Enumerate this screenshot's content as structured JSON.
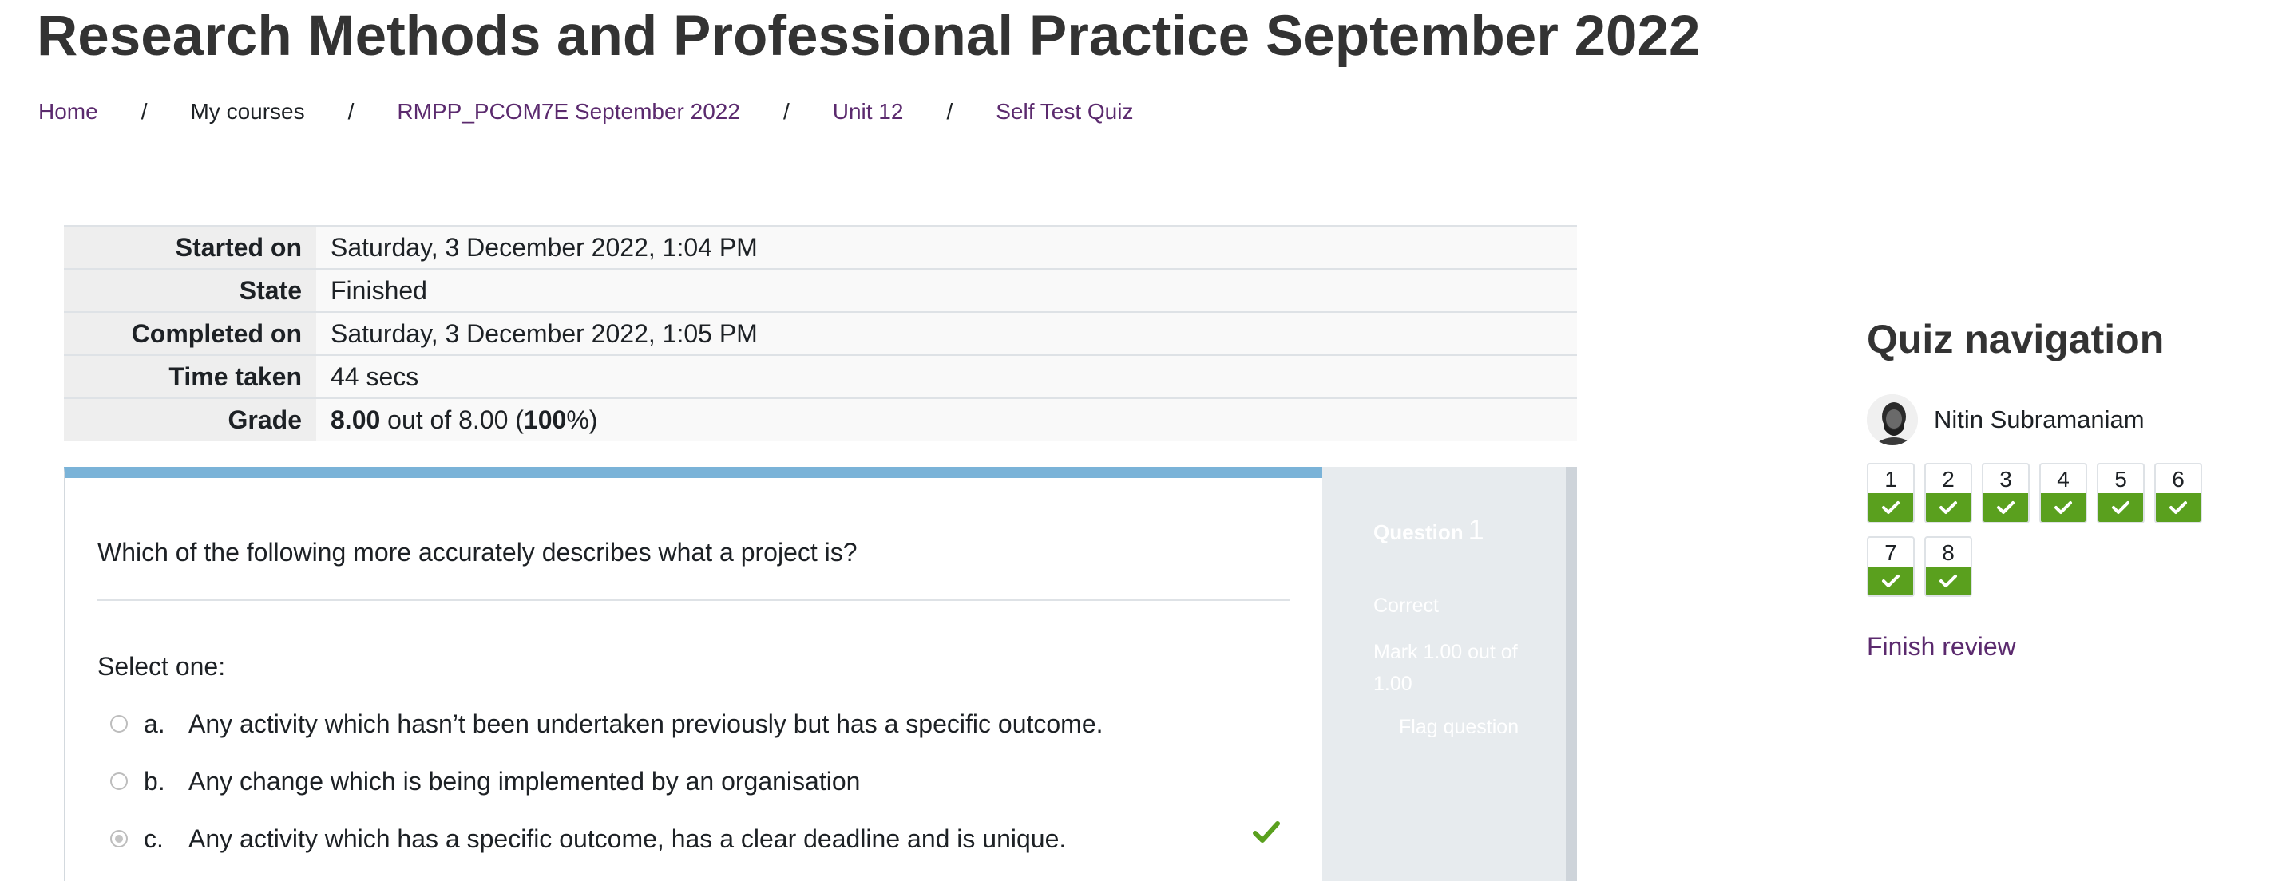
{
  "page": {
    "title": "Research Methods and Professional Practice September 2022"
  },
  "breadcrumb": {
    "items": [
      {
        "label": "Home"
      },
      {
        "label": "My courses"
      },
      {
        "label": "RMPP_PCOM7E September 2022"
      },
      {
        "label": "Unit 12"
      },
      {
        "label": "Self Test Quiz"
      }
    ],
    "separator": "/"
  },
  "summary": {
    "rows": [
      {
        "label": "Started on",
        "value": "Saturday, 3 December 2022, 1:04 PM"
      },
      {
        "label": "State",
        "value": "Finished"
      },
      {
        "label": "Completed on",
        "value": "Saturday, 3 December 2022, 1:05 PM"
      },
      {
        "label": "Time taken",
        "value": "44 secs"
      },
      {
        "label": "Grade",
        "value_strong": "8.00",
        "value_mid": " out of 8.00 (",
        "value_pct": "100",
        "value_end": "%)"
      }
    ]
  },
  "question": {
    "info": {
      "label": "Question",
      "number": "1",
      "state": "Correct",
      "grade": "Mark 1.00 out of 1.00",
      "flag": "Flag question"
    },
    "text": "Which of the following more accurately describes what a project is?",
    "prompt": "Select one:",
    "answers": [
      {
        "letter": "a.",
        "text": "Any activity which hasn’t been undertaken previously but has a specific outcome.",
        "selected": false
      },
      {
        "letter": "b.",
        "text": "Any change which is being implemented by an organisation",
        "selected": false
      },
      {
        "letter": "c.",
        "text": "Any activity which has a specific outcome, has a clear deadline and is unique.",
        "selected": true,
        "correct": true
      }
    ]
  },
  "quiz_nav": {
    "title": "Quiz navigation",
    "user_name": "Nitin Subramaniam",
    "questions": [
      {
        "number": "1",
        "status": "correct"
      },
      {
        "number": "2",
        "status": "correct"
      },
      {
        "number": "3",
        "status": "correct"
      },
      {
        "number": "4",
        "status": "correct"
      },
      {
        "number": "5",
        "status": "correct"
      },
      {
        "number": "6",
        "status": "correct"
      },
      {
        "number": "7",
        "status": "correct"
      },
      {
        "number": "8",
        "status": "correct"
      }
    ],
    "finish_label": "Finish review"
  },
  "colors": {
    "link": "#5b2a6e",
    "correct": "#5aa01e",
    "question_accent": "#7ab3d8"
  }
}
